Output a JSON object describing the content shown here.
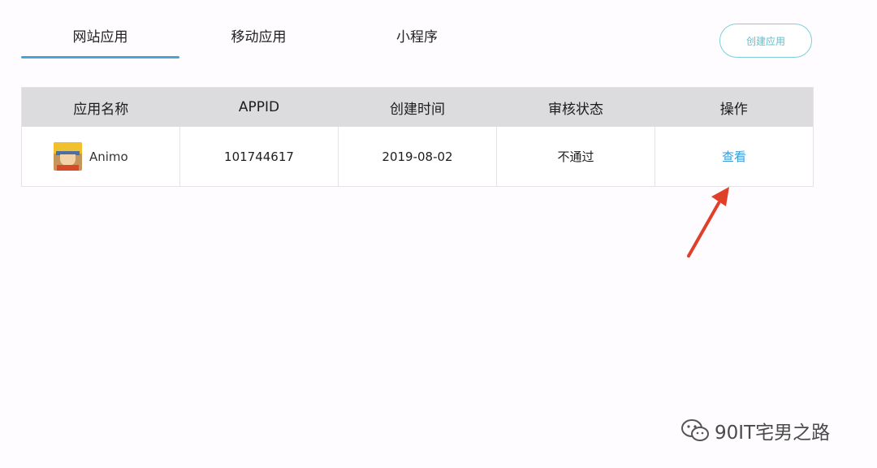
{
  "tabs": [
    {
      "label": "网站应用",
      "active": true
    },
    {
      "label": "移动应用",
      "active": false
    },
    {
      "label": "小程序",
      "active": false
    }
  ],
  "create_button": {
    "label": "创建应用"
  },
  "table": {
    "headers": [
      "应用名称",
      "APPID",
      "创建时间",
      "审核状态",
      "操作"
    ],
    "rows": [
      {
        "app_name": "Animo",
        "appid": "101744617",
        "created": "2019-08-02",
        "status": "不通过",
        "action": "查看"
      }
    ]
  },
  "colors": {
    "accent": "#4aa3d9",
    "status_rejected": "#e0465b",
    "link": "#3e9bd8",
    "annotation_arrow": "#e0402a"
  },
  "watermark": {
    "text": "90IT宅男之路",
    "icon": "wechat-icon"
  }
}
